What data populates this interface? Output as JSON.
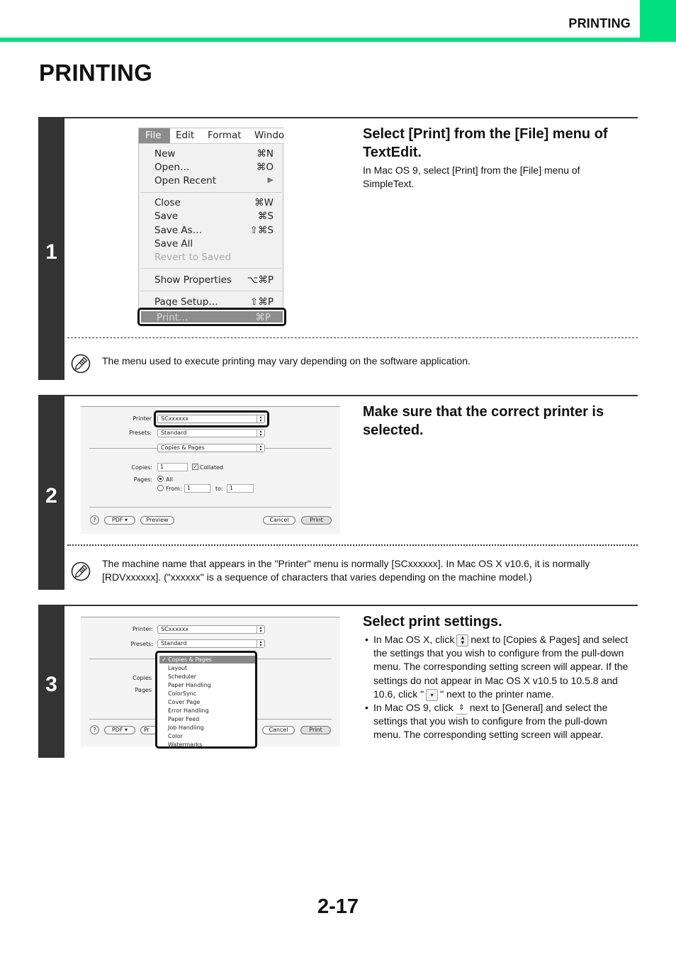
{
  "header": {
    "section_title": "PRINTING",
    "accent_color": "#00e07f"
  },
  "page_title": "PRINTING",
  "steps": [
    {
      "number": "1",
      "heading": "Select [Print] from the [File] menu of TextEdit.",
      "description": "In Mac OS 9, select [Print] from the [File] menu of SimpleText.",
      "note": "The menu used to execute printing may vary depending on the software application.",
      "menu": {
        "menubar": [
          "File",
          "Edit",
          "Format",
          "Windo"
        ],
        "items": [
          {
            "label": "New",
            "shortcut": "⌘N"
          },
          {
            "label": "Open…",
            "shortcut": "⌘O"
          },
          {
            "label": "Open Recent",
            "shortcut": "▶"
          },
          {
            "label": "Close",
            "shortcut": "⌘W"
          },
          {
            "label": "Save",
            "shortcut": "⌘S"
          },
          {
            "label": "Save As…",
            "shortcut": "⇧⌘S"
          },
          {
            "label": "Save All",
            "shortcut": ""
          },
          {
            "label": "Revert to Saved",
            "shortcut": ""
          },
          {
            "label": "Show Properties",
            "shortcut": "⌥⌘P"
          },
          {
            "label": "Page Setup…",
            "shortcut": "⇧⌘P"
          },
          {
            "label": "Print…",
            "shortcut": "⌘P"
          }
        ]
      }
    },
    {
      "number": "2",
      "heading": "Make sure that the correct printer is selected.",
      "note": "The machine name that appears in the \"Printer\" menu is normally [SCxxxxxx]. In Mac OS X v10.6, it is normally [RDVxxxxxx]. (\"xxxxxx\" is a sequence of characters that varies depending on the machine model.)",
      "dialog": {
        "printer_label": "Printer",
        "printer_value": "SCxxxxxx",
        "presets_label": "Presets:",
        "presets_value": "Standard",
        "panel_value": "Copies & Pages",
        "copies_label": "Copies:",
        "copies_value": "1",
        "collated_label": "Collated",
        "pages_label": "Pages:",
        "all_label": "All",
        "from_label": "From:",
        "from_value": "1",
        "to_label": "to:",
        "to_value": "1",
        "help": "?",
        "pdf": "PDF ▾",
        "preview": "Preview",
        "cancel": "Cancel",
        "print": "Print"
      }
    },
    {
      "number": "3",
      "heading": "Select print settings.",
      "bullets": {
        "b1_part1": "In Mac OS X, click",
        "b1_part2": "next to [Copies & Pages] and select the settings that you wish to configure from the pull-down menu. The corresponding setting screen will appear. If the settings do not appear in Mac OS X v10.5 to 10.5.8 and 10.6, click \"",
        "b1_part3": "\" next to the printer name.",
        "b2_part1": "In Mac OS 9, click",
        "b2_part2": "next to [General] and select the settings that you wish to configure from the pull-down menu. The corresponding setting screen will appear."
      },
      "dialog": {
        "printer_label": "Printer:",
        "printer_value": "SCxxxxxx",
        "presets_label": "Presets:",
        "presets_value": "Standard",
        "copies_label": "Copies",
        "pages_label": "Pages",
        "help": "?",
        "pdf": "PDF ▾",
        "preview_partial": "Pr",
        "cancel": "Cancel",
        "print": "Print",
        "dropdown_items": [
          "✓ Copies & Pages",
          "Layout",
          "Scheduler",
          "Paper Handling",
          "ColorSync",
          "Cover Page",
          "Error Handling",
          "Paper Feed",
          "Job Handling",
          "Color",
          "Watermarks"
        ]
      }
    }
  ],
  "page_number": "2-17"
}
